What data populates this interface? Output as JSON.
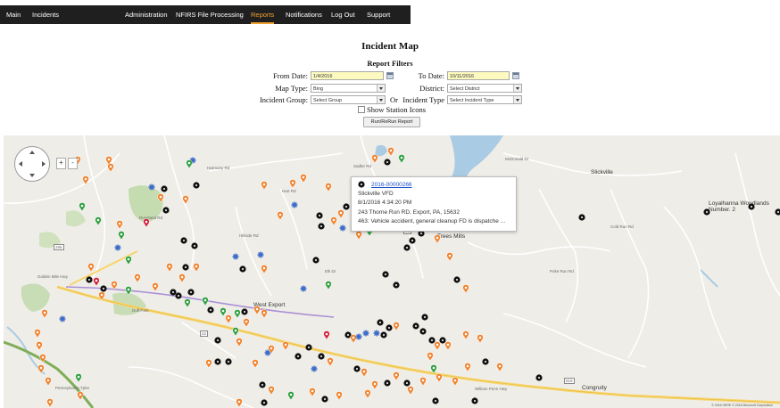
{
  "nav": {
    "items": [
      {
        "label": "Main",
        "active": false
      },
      {
        "label": "Incidents",
        "active": false
      },
      {
        "label": "Administration",
        "active": false
      },
      {
        "label": "NFIRS File Processing",
        "active": false
      },
      {
        "label": "Reports",
        "active": true
      },
      {
        "label": "Notifications",
        "active": false
      },
      {
        "label": "Log Out",
        "active": false
      },
      {
        "label": "Support",
        "active": false
      }
    ],
    "active_color": "#f0a030",
    "background": "#1f1f1f"
  },
  "page": {
    "title": "Incident Map",
    "filters_title": "Report Filters"
  },
  "filters": {
    "from_date_label": "From Date:",
    "from_date_value": "1/4/2016",
    "to_date_label": "To Date:",
    "to_date_value": "10/11/2016",
    "map_type_label": "Map Type:",
    "map_type_value": "Bing",
    "district_label": "District:",
    "district_value": "Select District",
    "incident_group_label": "Incident Group:",
    "incident_group_value": "Select Group",
    "or_label": "Or",
    "incident_type_label": "Incident Type",
    "incident_type_value": "Select Incident Type",
    "show_station_icons_label": "Show Station Icons",
    "run_button_label": "Run/ReRun Report"
  },
  "map": {
    "place_labels": [
      "Slickville",
      "West Export",
      "Trees Mills",
      "Congruity",
      "Loyalhanna Woodlands Number. 2"
    ],
    "road_labels": [
      "McDonald Dr",
      "Sadler Rd",
      "Harmony Rd",
      "Hart Rd",
      "Elk Dr",
      "Poke Run Rd",
      "Roseland Rd",
      "William Penn Hwy",
      "Pennsylvania Tpke",
      "Golden Mile Hwy",
      "Duff Park",
      "Hillside Rd",
      "Cold Run Rd"
    ],
    "shield_labels": [
      "286",
      "22",
      "66",
      "819"
    ],
    "copyright": "© 2016 HERE © 2016 Microsoft Corporation",
    "zoom_in": "+",
    "zoom_out": "-",
    "marker_colors": {
      "hazard": "#111111",
      "ems": "#f0822d",
      "fire": "#e33b2e",
      "check": "#2d9f3f",
      "other": "#3a6bc8",
      "pin": "#d2203a"
    }
  },
  "popup": {
    "incident_number": "2016-00000266",
    "station": "Slickville VFD",
    "datetime": "8/1/2016 4:34:20 PM",
    "address": "243 Thorne Run RD, Export, PA, 15632",
    "description": "463: Vehicle accident, general cleanup FD is dispatche ..."
  }
}
